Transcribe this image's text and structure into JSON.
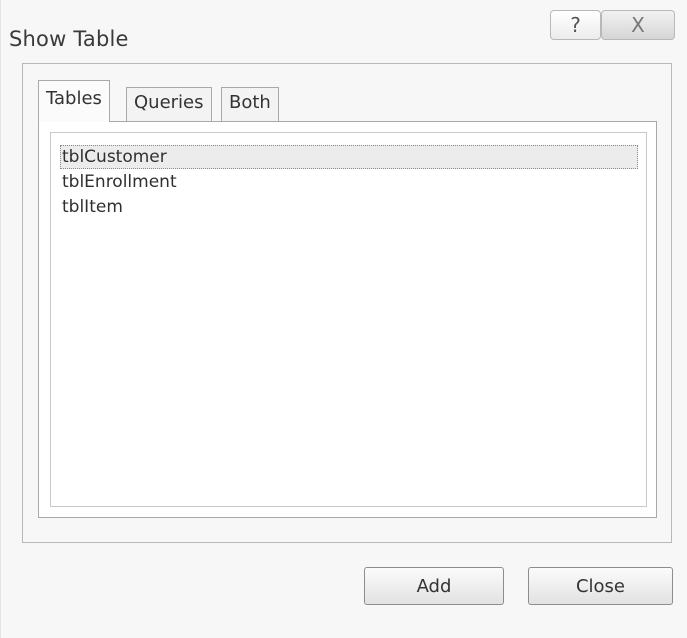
{
  "dialog": {
    "title": "Show Table",
    "help_glyph": "?",
    "close_glyph": "X"
  },
  "tabs": [
    {
      "label": "Tables",
      "active": true
    },
    {
      "label": "Queries",
      "active": false
    },
    {
      "label": "Both",
      "active": false
    }
  ],
  "tables": [
    {
      "name": "tblCustomer",
      "selected": true
    },
    {
      "name": "tblEnrollment",
      "selected": false
    },
    {
      "name": "tblItem",
      "selected": false
    }
  ],
  "buttons": {
    "add_label": "Add",
    "close_label": "Close"
  }
}
